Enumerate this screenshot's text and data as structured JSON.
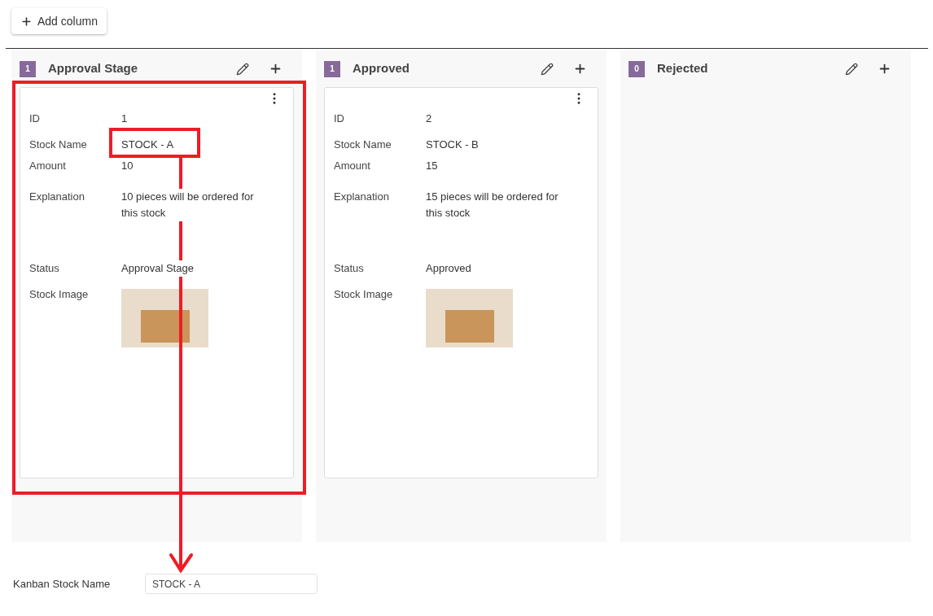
{
  "toolbar": {
    "add_button": "Add column"
  },
  "columns": [
    {
      "title": "Approval Stage",
      "count": "1",
      "cards": [
        {
          "fields": [
            {
              "kind": "text",
              "label": "ID",
              "value": "1"
            },
            {
              "kind": "text",
              "label": "Stock Name",
              "value": "STOCK - A"
            },
            {
              "kind": "text",
              "label": "Amount",
              "value": "10"
            },
            {
              "kind": "long",
              "label": "Explanation",
              "value": "10 pieces will be ordered for this stock"
            },
            {
              "kind": "text",
              "label": "Status",
              "value": "Approval Stage"
            },
            {
              "kind": "image",
              "label": "Stock Image"
            }
          ]
        }
      ]
    },
    {
      "title": "Approved",
      "count": "1",
      "cards": [
        {
          "fields": [
            {
              "kind": "text",
              "label": "ID",
              "value": "2"
            },
            {
              "kind": "text",
              "label": "Stock Name",
              "value": "STOCK - B"
            },
            {
              "kind": "text",
              "label": "Amount",
              "value": "15"
            },
            {
              "kind": "long",
              "label": "Explanation",
              "value": "15 pieces will be ordered for this stock"
            },
            {
              "kind": "text",
              "label": "Status",
              "value": "Approved"
            },
            {
              "kind": "image",
              "label": "Stock Image"
            }
          ]
        }
      ]
    },
    {
      "title": "Rejected",
      "count": "0"
    }
  ],
  "form": {
    "label": "Kanban Stock Name",
    "value": "STOCK - A"
  }
}
